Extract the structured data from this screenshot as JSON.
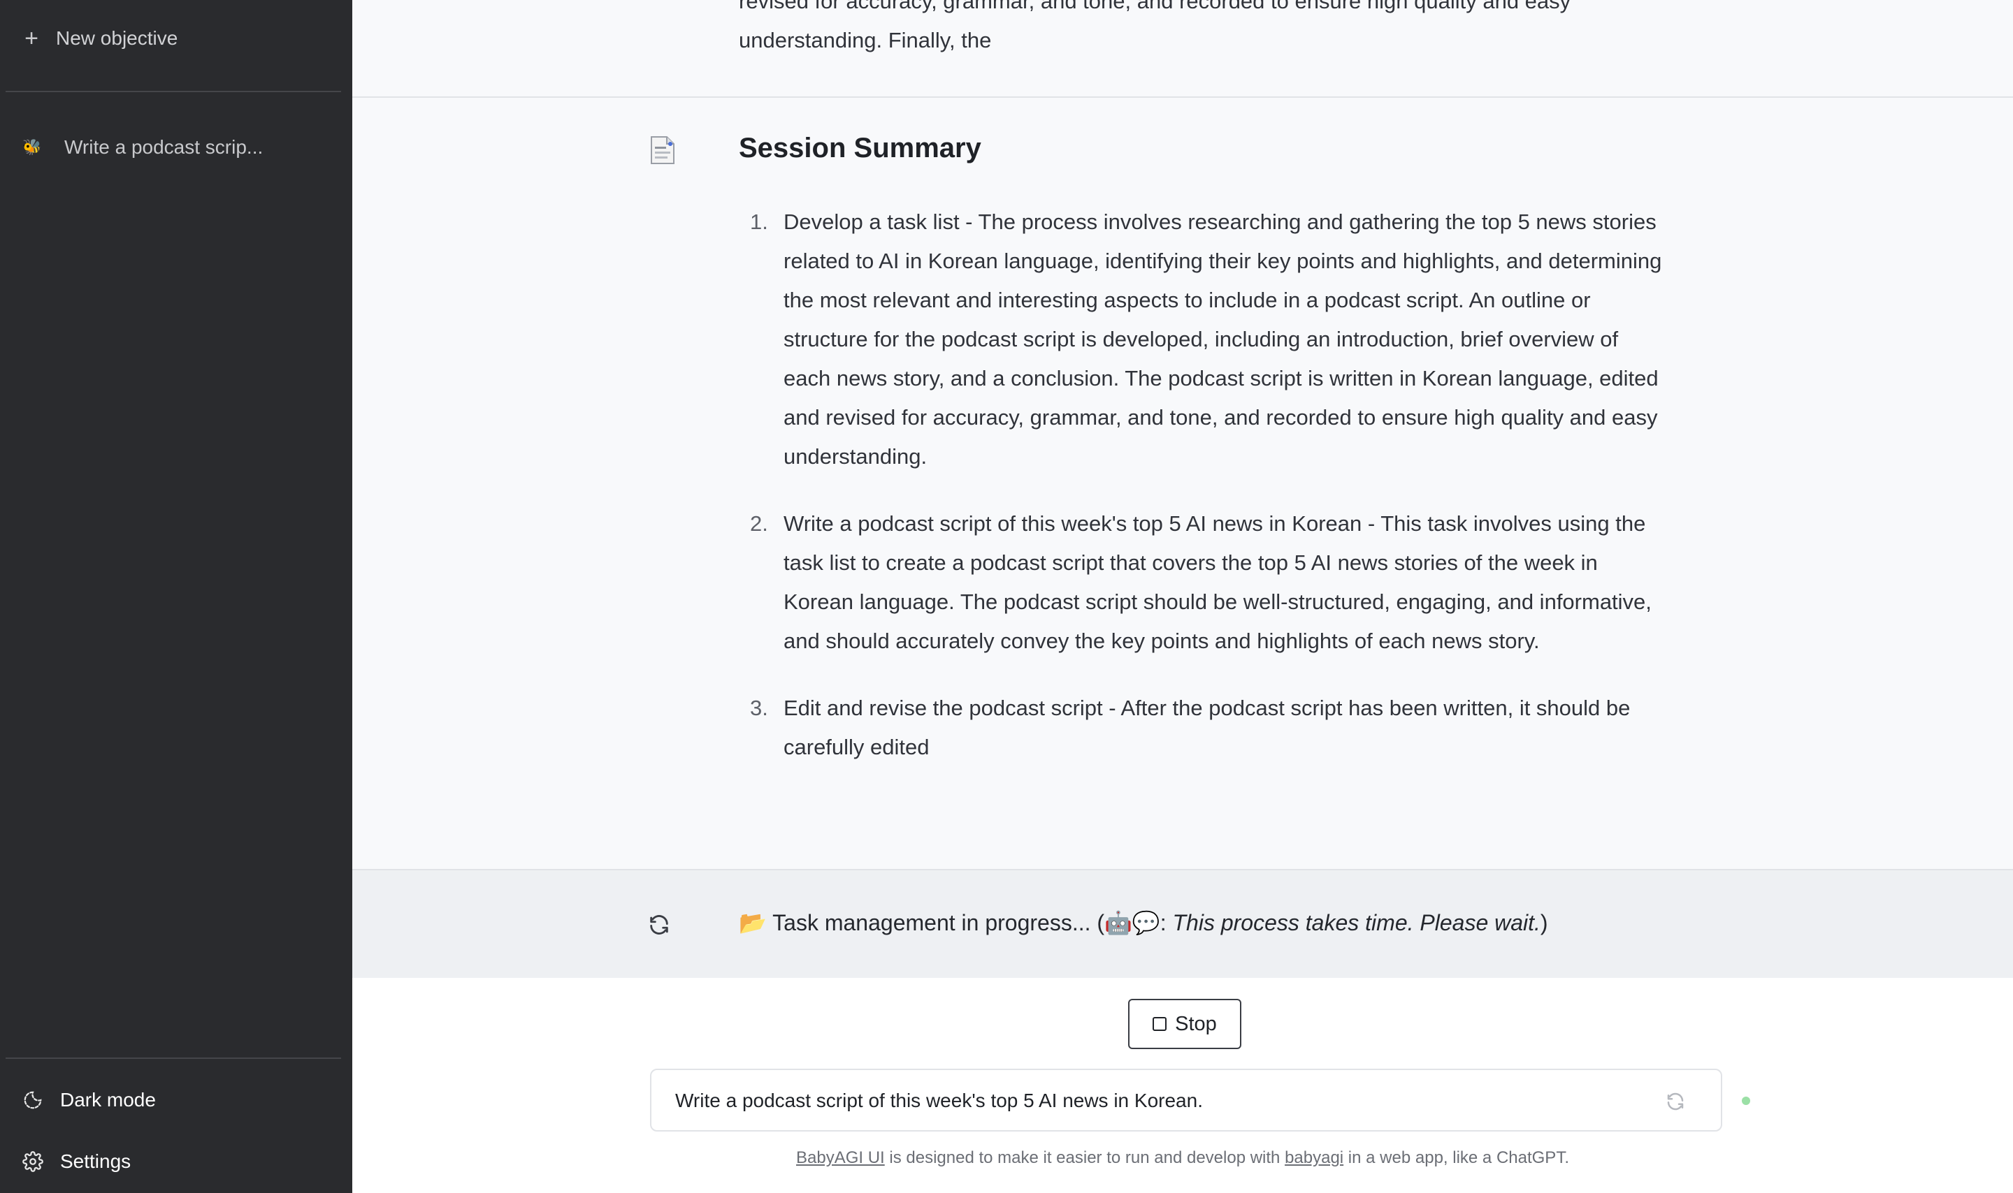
{
  "sidebar": {
    "new_objective_label": "New objective",
    "history": [
      {
        "label": "Write a podcast scrip...",
        "icon": "bee-emoji"
      }
    ],
    "dark_mode_label": "Dark mode",
    "settings_label": "Settings"
  },
  "main": {
    "previous_text": "revised for accuracy, grammar, and tone, and recorded to ensure high quality and easy understanding. Finally, the",
    "summary": {
      "title": "Session Summary",
      "items": [
        {
          "num": "1.",
          "text": "Develop a task list - The process involves researching and gathering the top 5 news stories related to AI in Korean language, identifying their key points and highlights, and determining the most relevant and interesting aspects to include in a podcast script. An outline or structure for the podcast script is developed, including an introduction, brief overview of each news story, and a conclusion. The podcast script is written in Korean language, edited and revised for accuracy, grammar, and tone, and recorded to ensure high quality and easy understanding."
        },
        {
          "num": "2.",
          "text": "Write a podcast script of this week's top 5 AI news in Korean - This task involves using the task list to create a podcast script that covers the top 5 AI news stories of the week in Korean language. The podcast script should be well-structured, engaging, and informative, and should accurately convey the key points and highlights of each news story."
        },
        {
          "num": "3.",
          "text": "Edit and revise the podcast script - After the podcast script has been written, it should be carefully edited"
        }
      ]
    },
    "progress": {
      "icon": "📂",
      "text": "Task management in progress... (",
      "robot_icon": "🤖💬",
      "colon": ": ",
      "note": "This process takes time. Please wait.",
      "close": ")"
    },
    "stop_label": "Stop",
    "input_value": "Write a podcast script of this week's top 5 AI news in Korean.",
    "footer": {
      "link1": "BabyAGI UI",
      "text1": " is designed to make it easier to run and develop with ",
      "link2": "babyagi",
      "text2": " in a web app, like a ChatGPT."
    }
  },
  "colors": {
    "sidebar_bg": "#2a2b2e",
    "main_bg": "#f8f9fb",
    "progress_bg": "#eef0f3",
    "status_dot": "#9be0a6"
  }
}
